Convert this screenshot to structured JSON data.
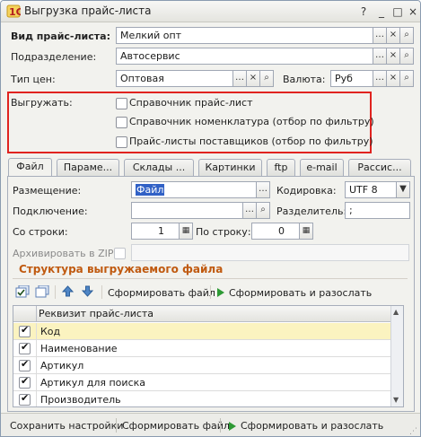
{
  "window": {
    "title": "Выгрузка прайс-листа"
  },
  "header": {
    "price_type_label": "Вид прайс-листа:",
    "price_type_value": "Мелкий опт",
    "division_label": "Подразделение:",
    "division_value": "Автосервис",
    "price_kind_label": "Тип цен:",
    "price_kind_value": "Оптовая",
    "currency_label": "Валюта:",
    "currency_value": "Руб"
  },
  "export": {
    "label": "Выгружать:",
    "options": [
      {
        "label": "Справочник прайс-лист",
        "checked": false
      },
      {
        "label": "Справочник номенклатура (отбор по фильтру)",
        "checked": false
      },
      {
        "label": "Прайс-листы поставщиков (отбор по фильтру)",
        "checked": false
      }
    ]
  },
  "tabs": [
    "Файл",
    "Параме...",
    "Склады ...",
    "Картинки",
    "ftp",
    "e-mail",
    "Расcис..."
  ],
  "file_tab": {
    "placement_label": "Размещение:",
    "placement_value": "Файл",
    "encoding_label": "Кодировка:",
    "encoding_value": "UTF 8",
    "connection_label": "Подключение:",
    "connection_value": "",
    "separator_label": "Разделитель:",
    "separator_value": ";",
    "from_row_label": "Со строки:",
    "from_row_value": "1",
    "to_row_label": "По строку:",
    "to_row_value": "0",
    "archive_label": "Архивировать в ZIP:"
  },
  "structure": {
    "title": "Структура выгружаемого файла",
    "form_file_label": "Сформировать файл",
    "form_send_label": "Сформировать и разослать",
    "column_header": "Реквизит прайс-листа",
    "rows": [
      {
        "label": "Код",
        "checked": true
      },
      {
        "label": "Наименование",
        "checked": true
      },
      {
        "label": "Артикул",
        "checked": true
      },
      {
        "label": "Артикул для поиска",
        "checked": true
      },
      {
        "label": "Производитель",
        "checked": true
      }
    ]
  },
  "bottom": {
    "save_settings": "Сохранить настройки",
    "form_file": "Сформировать файл",
    "form_send": "Сформировать и разослать"
  },
  "colors": {
    "highlight_border": "#e0231f",
    "section_title": "#c05a10",
    "selected_row": "#fbf3c0"
  }
}
